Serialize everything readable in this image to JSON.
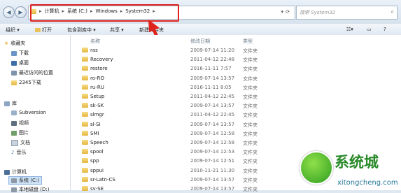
{
  "address": {
    "crumbs": [
      "计算机",
      "系统 (C:)",
      "Windows",
      "System32"
    ]
  },
  "search": {
    "placeholder": "搜索 System32"
  },
  "toolbar": {
    "organize": "组织 ▾",
    "open": "打开",
    "include": "包含到库中 ▾",
    "share": "共享 ▾",
    "new_folder": "新建文件夹"
  },
  "sidebar": {
    "favorites": "收藏夹",
    "downloads": "下载",
    "desktop": "桌面",
    "recent": "最近访问的位置",
    "downloads2345": "2345下载",
    "libraries": "库",
    "subversion": "Subversion",
    "videos": "视频",
    "pictures": "图片",
    "documents": "文档",
    "music": "音乐",
    "computer": "计算机",
    "drive_c": "系统 (C:)",
    "drive_d": "本地磁盘 (D:)"
  },
  "columns": {
    "name": "名称",
    "date": "修改日期",
    "type": "类型"
  },
  "files": [
    {
      "name": "ras",
      "date": "2009-07-14 11:20",
      "type": "文件夹"
    },
    {
      "name": "Recovery",
      "date": "2011-04-12 22:48",
      "type": "文件夹"
    },
    {
      "name": "restore",
      "date": "2016-11-11 7:57",
      "type": "文件夹"
    },
    {
      "name": "ro-RO",
      "date": "2009-07-14 13:57",
      "type": "文件夹"
    },
    {
      "name": "ru-RU",
      "date": "2016-11-11 8:05",
      "type": "文件夹"
    },
    {
      "name": "Setup",
      "date": "2011-04-12 22:45",
      "type": "文件夹"
    },
    {
      "name": "sk-SK",
      "date": "2009-07-14 13:57",
      "type": "文件夹"
    },
    {
      "name": "slmgr",
      "date": "2011-04-12 22:45",
      "type": "文件夹"
    },
    {
      "name": "sl-SI",
      "date": "2009-07-14 13:57",
      "type": "文件夹"
    },
    {
      "name": "SMI",
      "date": "2009-07-14 12:58",
      "type": "文件夹"
    },
    {
      "name": "Speech",
      "date": "2009-07-14 12:58",
      "type": "文件夹"
    },
    {
      "name": "spool",
      "date": "2009-07-14 12:53",
      "type": "文件夹"
    },
    {
      "name": "spp",
      "date": "2009-07-14 12:51",
      "type": "文件夹"
    },
    {
      "name": "sppui",
      "date": "2010-11-21 11:30",
      "type": "文件夹"
    },
    {
      "name": "sr-Latn-CS",
      "date": "2009-07-14 13:57",
      "type": "文件夹"
    },
    {
      "name": "sv-SE",
      "date": "2009-07-14 13:57",
      "type": "文件夹"
    }
  ],
  "watermark": {
    "title": "系统城",
    "url": "xitongcheng.com"
  },
  "colors": {
    "highlight": "#e0221f",
    "arrow": "#e0221f"
  }
}
